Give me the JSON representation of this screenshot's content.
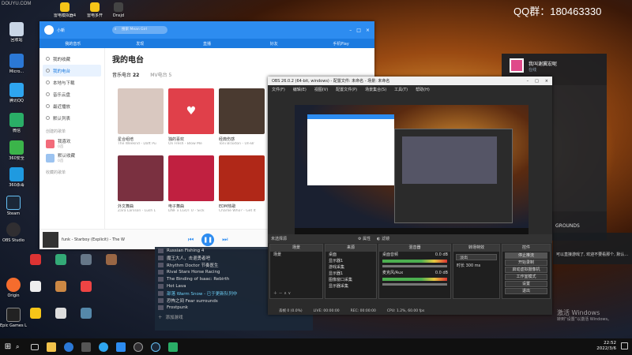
{
  "watermark": "QQ群：180463330",
  "desktop_icons": [
    {
      "label": "回收站",
      "color": "#c9d6e6"
    },
    {
      "label": "Micro...",
      "color": "#2b78d6"
    },
    {
      "label": "腾讯QQ",
      "color": "#2ea5ef"
    },
    {
      "label": "微信",
      "color": "#2aae67"
    },
    {
      "label": "360安全",
      "color": "#3bb44a"
    },
    {
      "label": "360杀毒",
      "color": "#1f9ae0"
    },
    {
      "label": "Steam",
      "color": "#1b2838"
    },
    {
      "label": "OBS Studio",
      "color": "#302e31"
    },
    {
      "label": "Origin",
      "color": "#f56c2d"
    },
    {
      "label": "Epic Games Launcher",
      "color": "#222222"
    }
  ],
  "top_desktop_icons": [
    "DOUYU.COM",
    "雷电模拟器4",
    "雷电多开",
    "Dnsjd"
  ],
  "music_app": {
    "user": "小新",
    "search_placeholder": "搜索 Mean Girl",
    "tabs": [
      "我的音乐",
      "发现",
      "直播",
      "好友",
      "手机Play"
    ],
    "sidebar": [
      {
        "label": "我的收藏"
      },
      {
        "label": "我的电台"
      },
      {
        "label": "本地与下载"
      },
      {
        "label": "音乐云盘"
      },
      {
        "label": "最近播放"
      },
      {
        "label": "默认列表"
      }
    ],
    "created_header": "创建的歌单",
    "created": [
      {
        "label": "我喜欢",
        "count": "0首"
      },
      {
        "label": "默认收藏",
        "count": "0首"
      }
    ],
    "collected_header": "收藏的歌单",
    "page_title": "我的电台",
    "subtabs": [
      {
        "label": "音乐电台",
        "count": "22"
      },
      {
        "label": "MV电台",
        "count": "5"
      }
    ],
    "albums": [
      {
        "title": "星合组培",
        "sub": "The Weeknd - Daft Pu",
        "color": "#d9c8c0"
      },
      {
        "title": "独的喜欢",
        "sub": "Oli Fresh - Blow Me",
        "color": "#e0404a"
      },
      {
        "title": "经典伤感",
        "sub": "Toni Braxton - Un-Br",
        "color": "#4a3a30"
      },
      {
        "title": "欧美流行",
        "sub": "Jessie - Meme",
        "color": "#e8e0d8"
      },
      {
        "title": "外文舞曲",
        "sub": "Zara Larsson - Lush L",
        "color": "#7a3040"
      },
      {
        "title": "电子舞曲",
        "sub": "DNF x LGOT U - Sick",
        "color": "#c02040"
      },
      {
        "title": "EDM热歌",
        "sub": "Charlie Who? - Get It",
        "color": "#b02818"
      },
      {
        "title": "韩语热歌",
        "sub": "",
        "color": "#f0ece8"
      }
    ],
    "now_playing": "funk - Starboy (Explicit)",
    "now_playing_artist": "The W",
    "accent": "#2d8cf0"
  },
  "obs": {
    "title": "OBS 26.0.2 (64-bit, windows) - 配置文件: 未命名 - 场景: 未命名",
    "menu": [
      "文件(F)",
      "编辑(E)",
      "视图(V)",
      "配置文件(P)",
      "场景集合(S)",
      "工具(T)",
      "帮助(H)"
    ],
    "source_bar": "未选择源",
    "source_bar_props": "属性",
    "source_bar_filters": "滤镜",
    "docks": {
      "scenes": {
        "title": "场景",
        "items": [
          "场景"
        ]
      },
      "sources": {
        "title": "来源",
        "items": [
          "桌面",
          "显示器1",
          "游戏采集",
          "显示器1",
          "图像窗口采集",
          "显示器采集"
        ]
      },
      "mixer": {
        "title": "混音器",
        "tracks": [
          {
            "name": "桌面音频",
            "level": "0.0 dB"
          },
          {
            "name": "麦克风/Aux",
            "level": "0.0 dB"
          }
        ]
      },
      "transitions": {
        "title": "转场特效",
        "type": "淡出",
        "duration_label": "时长",
        "duration": "300 ms"
      },
      "controls": {
        "title": "控件",
        "buttons": [
          "停止推流",
          "开始录制",
          "启动虚拟摄像机",
          "工作室模式",
          "设置",
          "退出"
        ]
      }
    },
    "status": {
      "dropped": "丢帧 0 (0.0%)",
      "live": "LIVE: 00:00:00",
      "rec": "REC: 00:00:00",
      "cpu": "CPU: 1.2%, 60.00 fps"
    }
  },
  "steam_games": [
    "Russian Fishing 4",
    "魔王大人，击退勇者吧",
    "Rhythm Doctor 节奏医生",
    "Rival Stars Horse Racing",
    "The Binding of Isaac: Rebirth",
    "Hot Lava",
    "部落 Warm Snow - 已于更新队列中",
    "恐怖之间 Fear surrounds",
    "Frostpunk"
  ],
  "steam_footer": "添加游戏",
  "right_window": {
    "title": "我叫谢冀宏呢",
    "sub": "在线",
    "text1": "GROUNDS",
    "text2": "可以直接游戏了, 欢迎不要看那个, 默认..."
  },
  "activate": {
    "title": "激活 Windows",
    "sub": "转到“设置”以激活 Windows。"
  },
  "clock": {
    "time": "22:52",
    "date": "2022/3/6"
  }
}
